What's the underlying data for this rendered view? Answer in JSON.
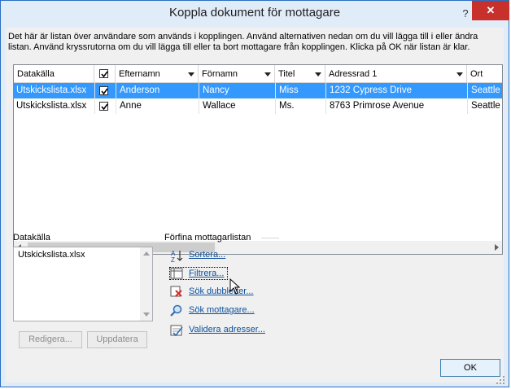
{
  "window": {
    "title": "Koppla dokument för mottagare",
    "help": "?",
    "close": "✕"
  },
  "description": "Det här är listan över användare som används i kopplingen. Använd alternativen nedan om du vill lägga till i eller ändra listan. Använd kryssrutorna om du vill lägga till eller ta bort mottagare från kopplingen. Klicka på OK när listan är klar.",
  "grid": {
    "columns": [
      "Datakälla",
      "",
      "Efternamn",
      "Förnamn",
      "Titel",
      "Adressrad 1",
      "Ort"
    ],
    "rows": [
      {
        "source": "Utskickslista.xlsx",
        "checked": true,
        "last": "Anderson",
        "first": "Nancy",
        "title": "Miss",
        "address": "1232 Cypress Drive",
        "city": "Seattle",
        "selected": true
      },
      {
        "source": "Utskickslista.xlsx",
        "checked": true,
        "last": "Anne",
        "first": "Wallace",
        "title": "Ms.",
        "address": "8763 Primrose Avenue",
        "city": "Seattle",
        "selected": false
      }
    ]
  },
  "datasource": {
    "label": "Datakälla",
    "items": [
      "Utskickslista.xlsx"
    ],
    "edit_button": "Redigera...",
    "refresh_button": "Uppdatera"
  },
  "refine": {
    "label": "Förfina mottagarlistan",
    "links": [
      "Sortera...",
      "Filtrera...",
      "Sök dubbletter...",
      "Sök mottagare...",
      "Validera adresser..."
    ]
  },
  "ok_button": "OK",
  "colors": {
    "selection": "#3399ff",
    "link": "#0b4f9c",
    "close": "#c7302b"
  }
}
